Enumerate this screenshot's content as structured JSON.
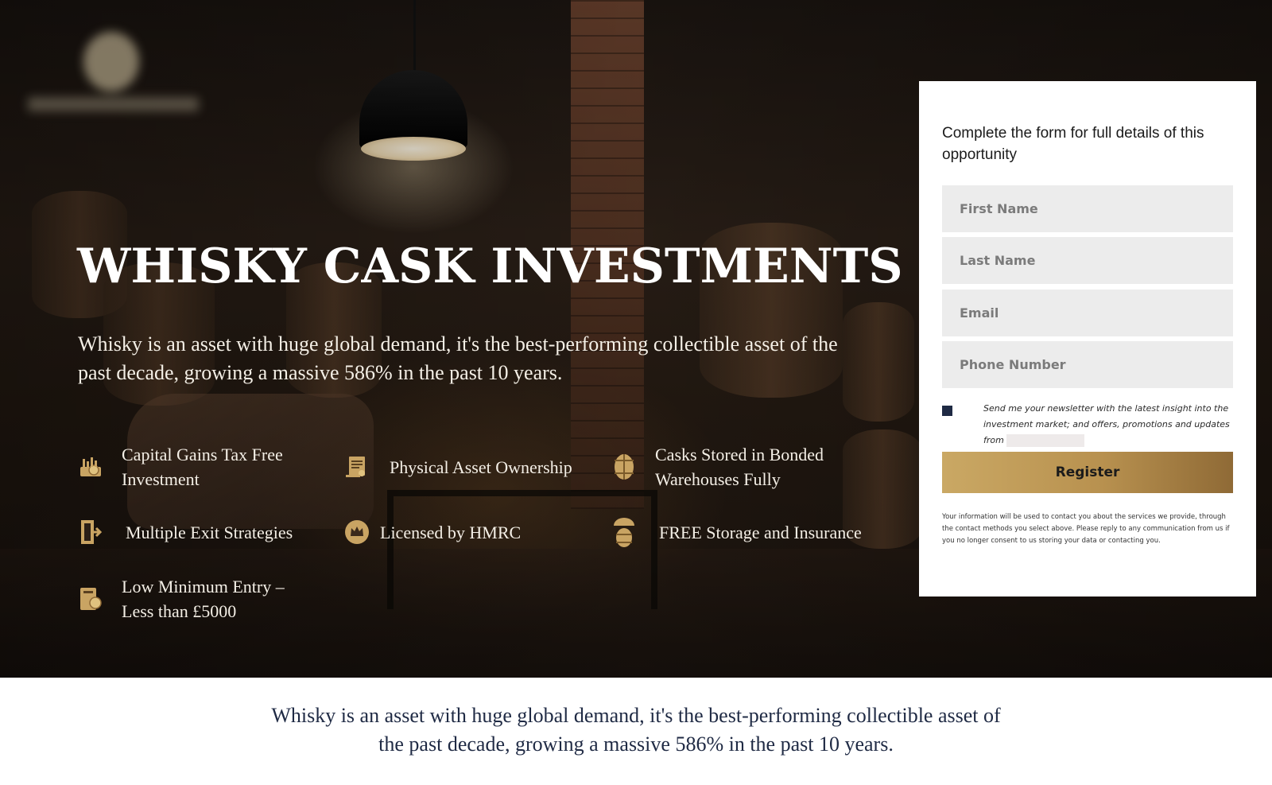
{
  "hero": {
    "title": "WHISKY CASK INVESTMENTS",
    "subtitle": "Whisky is an asset with huge global demand, it's the best-performing collectible asset of the past decade, growing a massive 586% in the past 10 years."
  },
  "features": [
    {
      "label": "Capital Gains Tax Free Investment",
      "icon": "gold-coins-icon"
    },
    {
      "label": "Physical Asset Ownership",
      "icon": "certificate-icon"
    },
    {
      "label": "Casks Stored in Bonded Warehouses Fully",
      "icon": "barrel-icon"
    },
    {
      "label": "Multiple Exit Strategies",
      "icon": "exit-door-icon"
    },
    {
      "label": "Licensed by HMRC",
      "icon": "crown-icon"
    },
    {
      "label": "FREE Storage and Insurance",
      "icon": "umbrella-barrel-icon"
    },
    {
      "label": "Low Minimum Entry – Less than £5000",
      "icon": "money-icon"
    }
  ],
  "form": {
    "heading": "Complete the form for full details of this opportunity",
    "first_name_placeholder": "First Name",
    "last_name_placeholder": "Last Name",
    "email_placeholder": "Email",
    "phone_placeholder": "Phone Number",
    "consent_text": "Send me your newsletter with the latest insight into the investment market; and offers, promotions and updates from",
    "register_label": "Register",
    "privacy_text": "Your information will be used to contact you about the services we provide, through the contact methods you select above. Please reply to any communication from us if you no longer consent to us storing your data or contacting you."
  },
  "band": {
    "text": "Whisky is an asset with huge global demand, it's the best-performing collectible asset of the past decade, growing a massive 586% in the past 10 years."
  },
  "colors": {
    "gold": "#c9a463",
    "navy": "#1f2a44",
    "field_bg": "#ececec"
  }
}
